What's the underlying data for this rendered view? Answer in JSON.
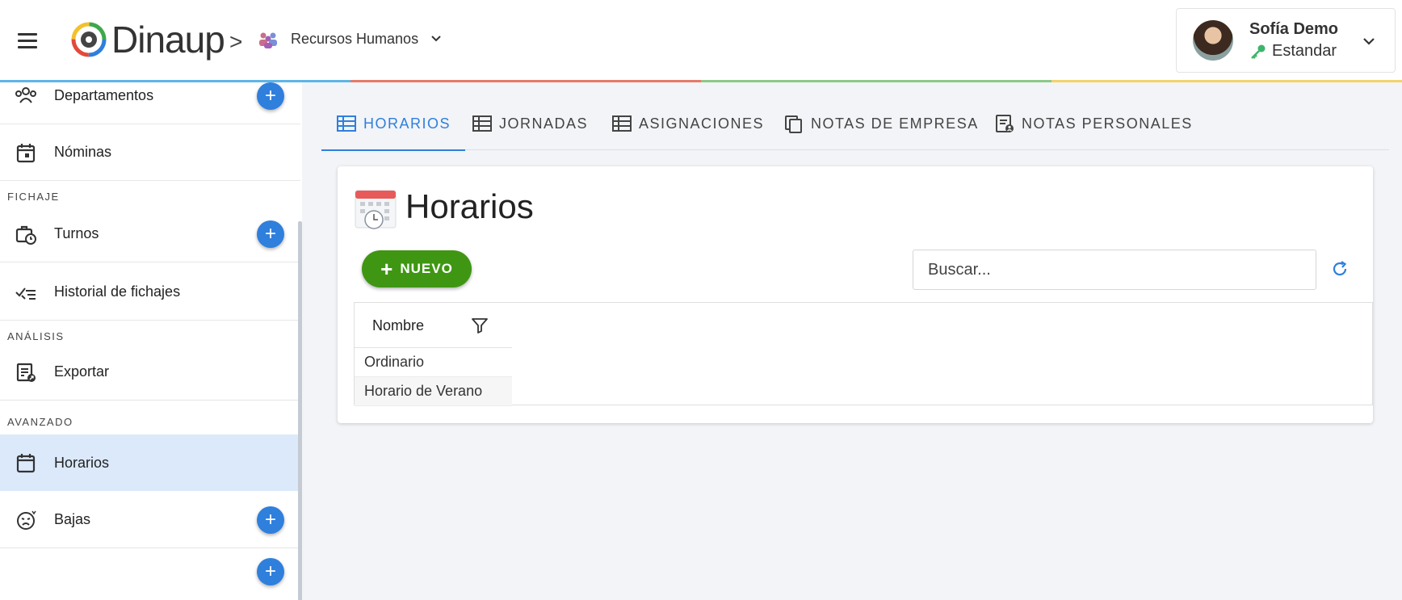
{
  "app": {
    "brand": "Dinaup",
    "breadcrumb_separator": ">",
    "module": "Recursos Humanos"
  },
  "user": {
    "name": "Sofía Demo",
    "role": "Estandar"
  },
  "colors": {
    "accent": "#2f7fdd",
    "primary_button": "#3f9613",
    "active_nav_bg": "#dbe9fb",
    "stripe": [
      "#5fb5e6",
      "#e57a6a",
      "#8cc98a",
      "#f2d36c"
    ]
  },
  "sidebar": {
    "items_top": [
      {
        "label": "Departamentos",
        "icon": "people-icon",
        "add": true
      },
      {
        "label": "Nóminas",
        "icon": "calendar-icon",
        "add": false
      }
    ],
    "sections": [
      {
        "title": "FICHAJE",
        "items": [
          {
            "label": "Turnos",
            "icon": "briefcase-clock-icon",
            "add": true
          },
          {
            "label": "Historial de fichajes",
            "icon": "checklist-icon",
            "add": false
          }
        ]
      },
      {
        "title": "ANÁLISIS",
        "items": [
          {
            "label": "Exportar",
            "icon": "export-doc-icon",
            "add": false
          }
        ]
      },
      {
        "title": "AVANZADO",
        "items": [
          {
            "label": "Horarios",
            "icon": "calendar-blank-icon",
            "add": false,
            "active": true
          },
          {
            "label": "Bajas",
            "icon": "sick-face-icon",
            "add": true
          }
        ]
      }
    ]
  },
  "tabs": [
    {
      "label": "HORARIOS",
      "icon": "table-icon",
      "active": true
    },
    {
      "label": "JORNADAS",
      "icon": "table-icon",
      "active": false
    },
    {
      "label": "ASIGNACIONES",
      "icon": "table-icon",
      "active": false
    },
    {
      "label": "NOTAS DE EMPRESA",
      "icon": "copy-notes-icon",
      "active": false
    },
    {
      "label": "NOTAS PERSONALES",
      "icon": "personal-notes-icon",
      "active": false
    }
  ],
  "page": {
    "title": "Horarios",
    "new_button": "NUEVO",
    "search_placeholder": "Buscar..."
  },
  "grid": {
    "column": "Nombre",
    "rows": [
      "Ordinario",
      "Horario de Verano"
    ]
  }
}
